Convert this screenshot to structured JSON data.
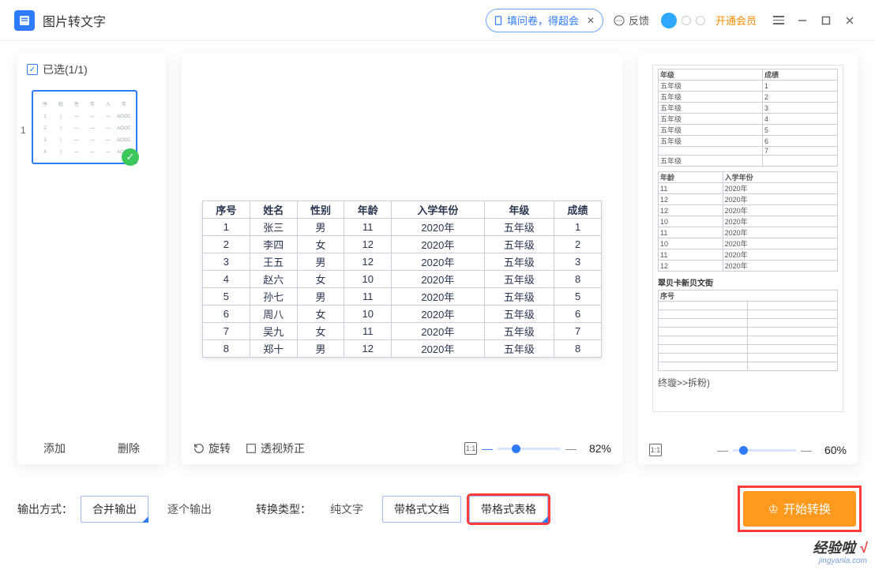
{
  "header": {
    "title": "图片转文字",
    "promo_label": "填问卷，得超会",
    "feedback_label": "反馈",
    "vip_label": "开通会员"
  },
  "left": {
    "selected_label": "已选(1/1)",
    "thumb_index": "1",
    "add_label": "添加",
    "delete_label": "删除"
  },
  "mid": {
    "tools": {
      "rotate": "旋转",
      "perspective": "透视矫正"
    },
    "zoom": "82%",
    "headers": [
      "序号",
      "姓名",
      "性别",
      "年龄",
      "入学年份",
      "年级",
      "成绩"
    ],
    "rows": [
      [
        "1",
        "张三",
        "男",
        "11",
        "2020年",
        "五年级",
        "1"
      ],
      [
        "2",
        "李四",
        "女",
        "12",
        "2020年",
        "五年级",
        "2"
      ],
      [
        "3",
        "王五",
        "男",
        "12",
        "2020年",
        "五年级",
        "3"
      ],
      [
        "4",
        "赵六",
        "女",
        "10",
        "2020年",
        "五年级",
        "8"
      ],
      [
        "5",
        "孙七",
        "男",
        "11",
        "2020年",
        "五年级",
        "5"
      ],
      [
        "6",
        "周八",
        "女",
        "10",
        "2020年",
        "五年级",
        "6"
      ],
      [
        "7",
        "吴九",
        "女",
        "11",
        "2020年",
        "五年级",
        "7"
      ],
      [
        "8",
        "郑十",
        "男",
        "12",
        "2020年",
        "五年级",
        "8"
      ]
    ]
  },
  "right": {
    "zoom": "60%",
    "preview": {
      "section1_head": [
        "年级",
        "成绩"
      ],
      "section1": [
        [
          "五年级",
          "1"
        ],
        [
          "五年级",
          "2"
        ],
        [
          "五年级",
          "3"
        ],
        [
          "五年级",
          "4"
        ],
        [
          "五年级",
          "5"
        ],
        [
          "五年级",
          "6"
        ],
        [
          " ",
          "7"
        ],
        [
          "五年级",
          ""
        ]
      ],
      "section2_head": [
        "年龄",
        "入学年份"
      ],
      "section2": [
        [
          "11",
          "2020年"
        ],
        [
          "12",
          "2020年"
        ],
        [
          "12",
          "2020年"
        ],
        [
          "10",
          "2020年"
        ],
        [
          "11",
          "2020年"
        ],
        [
          "10",
          "2020年"
        ],
        [
          "11",
          "2020年"
        ],
        [
          "12",
          "2020年"
        ]
      ],
      "section3_title": "翠贝卡新贝文街",
      "section3_head": "序号",
      "final": "终璇>>拆粉)"
    }
  },
  "footer": {
    "output_mode_label": "输出方式：",
    "merge_output": "合并输出",
    "split_output": "逐个输出",
    "type_label": "转换类型：",
    "plain_text": "纯文字",
    "format_doc": "带格式文档",
    "format_table": "带格式表格",
    "start_label": "开始转换"
  },
  "watermark": {
    "brand": "经验啦",
    "url": "jingyanla.com"
  }
}
